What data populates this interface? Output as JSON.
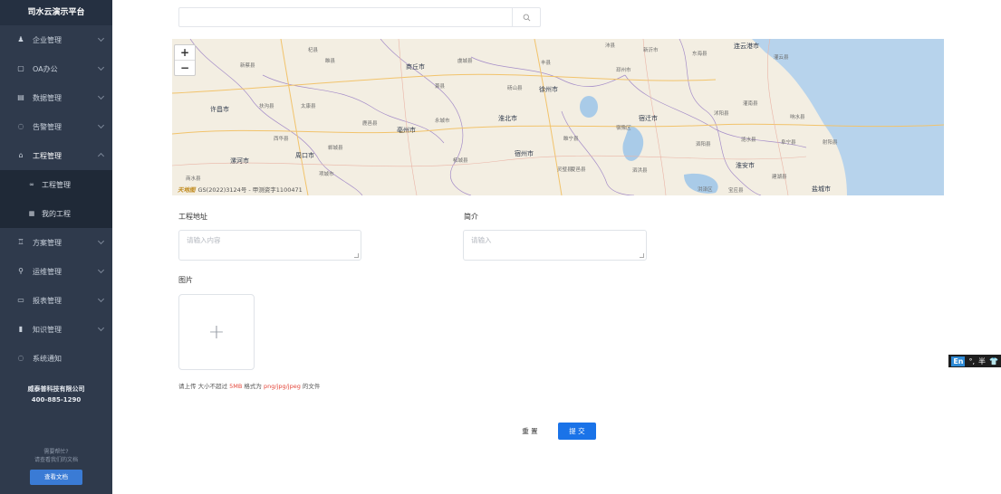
{
  "sidebar": {
    "brand": "司水云演示平台",
    "items": [
      {
        "label": "企业管理",
        "icon": "user-icon"
      },
      {
        "label": "OA办公",
        "icon": "document-icon"
      },
      {
        "label": "数据管理",
        "icon": "data-icon"
      },
      {
        "label": "告警管理",
        "icon": "alarm-icon"
      },
      {
        "label": "工程管理",
        "icon": "project-icon"
      }
    ],
    "submenu": [
      {
        "label": "工程管理",
        "icon": "link-icon"
      },
      {
        "label": "我的工程",
        "icon": "grid-icon"
      }
    ],
    "items2": [
      {
        "label": "方案管理",
        "icon": "plan-icon"
      },
      {
        "label": "运维管理",
        "icon": "wrench-icon"
      },
      {
        "label": "报表管理",
        "icon": "report-icon"
      },
      {
        "label": "知识管理",
        "icon": "book-icon"
      },
      {
        "label": "系统通知",
        "icon": "bell-icon"
      }
    ],
    "company_name": "威泰普科技有限公司",
    "phone": "400-885-1290",
    "help_line1": "需要帮忙?",
    "help_line2": "请查看我们的文档",
    "doc_button": "查看文档"
  },
  "search": {
    "value": "",
    "placeholder": ""
  },
  "map": {
    "zoom_in": "+",
    "zoom_out": "−",
    "copyright": "GS(2022)3124号 - 甲测资字1100471",
    "logo_text": "天地图",
    "cities": [
      "商丘市",
      "徐州市",
      "连云港市",
      "许昌市",
      "淮北市",
      "宿迁市",
      "亳州市",
      "周口市",
      "漯河市",
      "宿州市",
      "淮安市",
      "盐城市"
    ],
    "counties": [
      "杞县",
      "睢县",
      "虞城县",
      "新蔡县",
      "扶沟县",
      "太康县",
      "鹿邑县",
      "永城市",
      "灵璧县",
      "泗阳县",
      "沭阳县",
      "灌南县",
      "响水县",
      "涟水县",
      "阜宁县",
      "射阳县",
      "建湖县",
      "泗洪县",
      "洪泽区",
      "宝应县",
      "西华县",
      "郸城县",
      "项城市",
      "商水县",
      "睢宁县",
      "萧县",
      "丰县",
      "沛县",
      "东海县",
      "灌云县",
      "邳州市",
      "新沂市",
      "宿豫区",
      "砀山县",
      "夏邑县",
      "柘城县"
    ]
  },
  "form": {
    "address_label": "工程地址",
    "address_placeholder": "请输入内容",
    "intro_label": "简介",
    "intro_placeholder": "请输入",
    "image_label": "图片",
    "upload_plus": "+",
    "tip_prefix": "请上传 大小不超过 ",
    "tip_size": "5MB",
    "tip_mid": " 格式为 ",
    "tip_formats": "png/jpg/jpeg",
    "tip_suffix": " 的文件",
    "reset_label": "重 置",
    "submit_label": "提 交"
  },
  "ime": {
    "mode": "En",
    "punct": "°,",
    "half": "半",
    "shirt": "👕"
  },
  "colors": {
    "sidebar": "#2f3a4c",
    "primary": "#1a73e8",
    "accent_red": "#e4473b"
  }
}
